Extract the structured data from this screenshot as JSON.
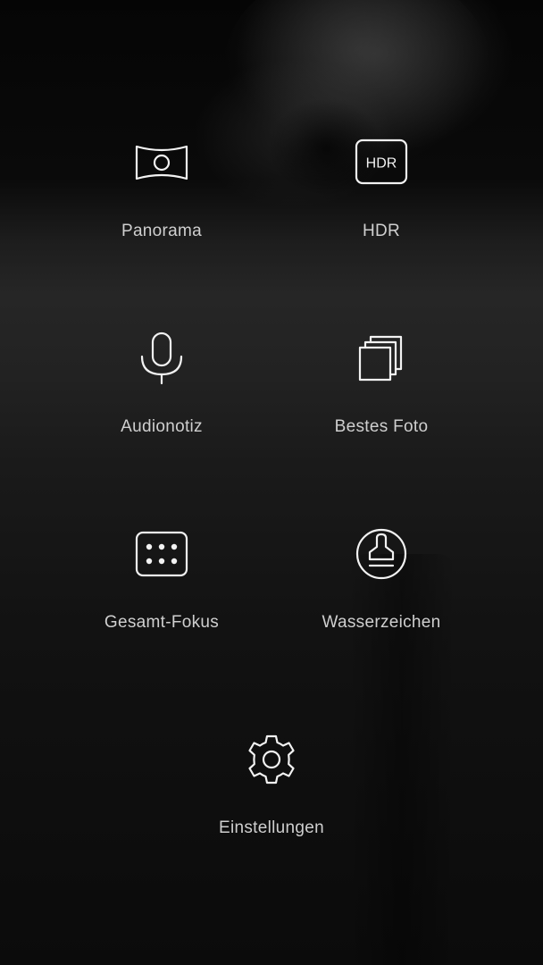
{
  "menu": {
    "items": [
      {
        "id": "panorama",
        "label": "Panorama",
        "icon": "panorama-icon"
      },
      {
        "id": "hdr",
        "label": "HDR",
        "icon": "hdr-icon",
        "icon_text": "HDR"
      },
      {
        "id": "audio-note",
        "label": "Audionotiz",
        "icon": "microphone-icon"
      },
      {
        "id": "best-photo",
        "label": "Bestes Foto",
        "icon": "stacked-photos-icon"
      },
      {
        "id": "all-focus",
        "label": "Gesamt-Fokus",
        "icon": "focus-dots-icon"
      },
      {
        "id": "watermark",
        "label": "Wasserzeichen",
        "icon": "stamp-icon"
      },
      {
        "id": "settings",
        "label": "Einstellungen",
        "icon": "gear-icon"
      }
    ]
  },
  "theme": {
    "icon_color": "#f2f2f2",
    "label_color": "#cfcfcf",
    "background": "#151515"
  }
}
